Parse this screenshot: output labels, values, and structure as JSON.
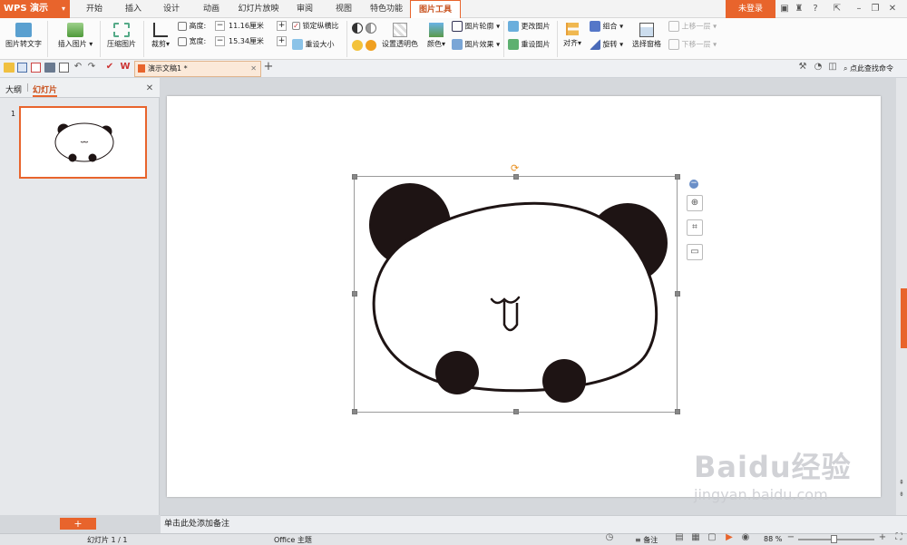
{
  "app": {
    "name": "WPS 演示"
  },
  "tabs": [
    {
      "label": "开始"
    },
    {
      "label": "插入"
    },
    {
      "label": "设计"
    },
    {
      "label": "动画"
    },
    {
      "label": "幻灯片放映"
    },
    {
      "label": "审阅"
    },
    {
      "label": "视图"
    },
    {
      "label": "特色功能"
    },
    {
      "label": "图片工具"
    }
  ],
  "account": {
    "login_label": "未登录"
  },
  "ribbon": {
    "pic_to_text": "图片转文字",
    "insert_pic": "插入图片",
    "compress": "压缩图片",
    "crop": "裁剪",
    "height_label": "高度:",
    "height_value": "11.16厘米",
    "width_label": "宽度:",
    "width_value": "15.34厘米",
    "lock_ratio": "锁定纵横比",
    "reset_size": "重设大小",
    "set_transparent": "设置透明色",
    "color": "颜色",
    "pic_outline": "图片轮廓",
    "pic_effect": "图片效果",
    "change_pic": "更改图片",
    "reset_pic": "重设图片",
    "align": "对齐",
    "group": "组合",
    "rotate": "旋转",
    "selection_pane": "选择窗格",
    "bring_forward": "上移一层",
    "send_backward": "下移一层"
  },
  "quickbar": {
    "doc_tab": "演示文稿1 *",
    "find_cmd": "点此查找命令"
  },
  "panel": {
    "outline_tab": "大纲",
    "slides_tab": "幻灯片",
    "slide_number": "1"
  },
  "notes": {
    "placeholder": "单击此处添加备注"
  },
  "status": {
    "slide_pos": "幻灯片 1 / 1",
    "theme": "Office 主题",
    "notes_btn": "备注",
    "zoom": "88 %"
  },
  "watermark": {
    "brand": "Baidu经验",
    "url": "jingyan.baidu.com"
  },
  "colors": {
    "accent": "#e8642c"
  }
}
